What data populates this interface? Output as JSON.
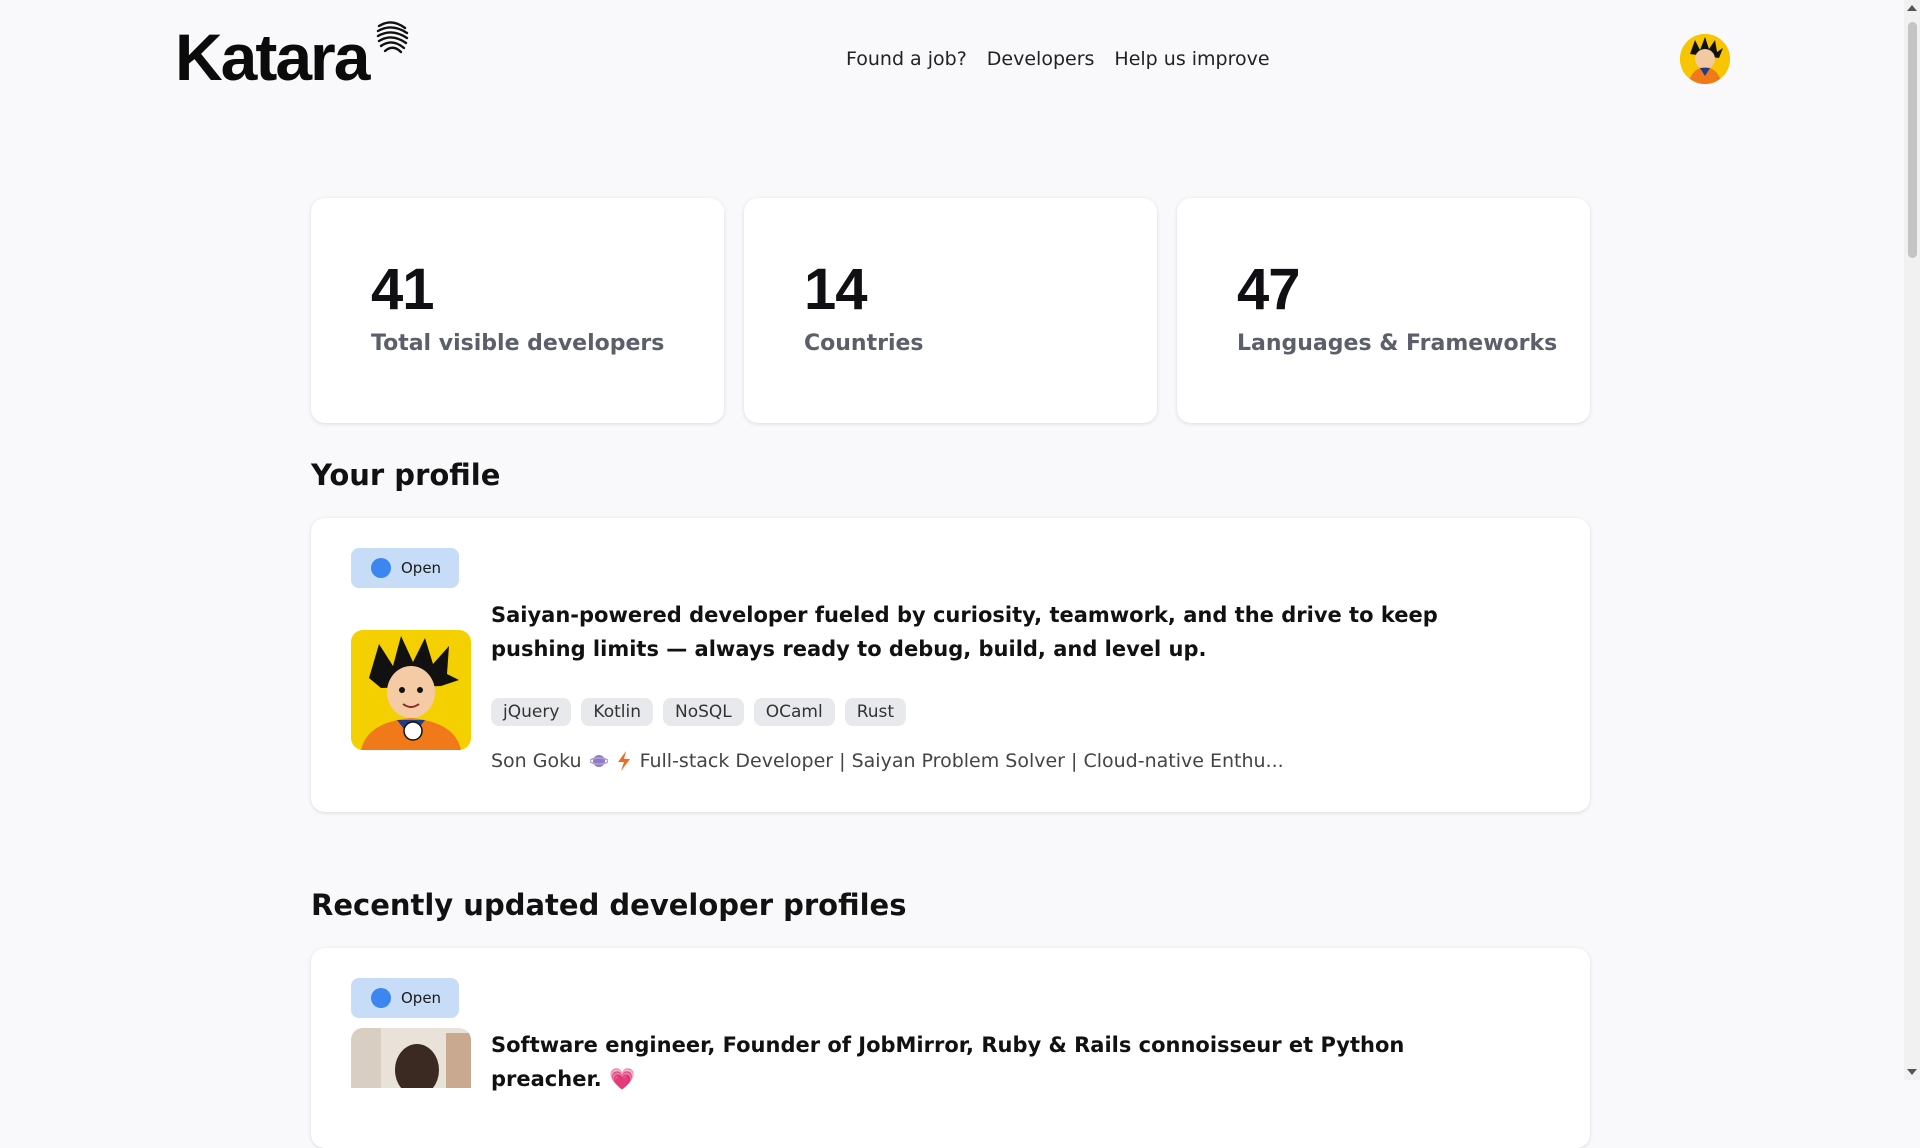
{
  "brand": {
    "name": "Katara"
  },
  "nav": {
    "items": [
      "Found a job?",
      "Developers",
      "Help us improve"
    ]
  },
  "stats": [
    {
      "value": "41",
      "label": "Total visible developers"
    },
    {
      "value": "14",
      "label": "Countries"
    },
    {
      "value": "47",
      "label": "Languages & Frameworks"
    }
  ],
  "your_profile": {
    "title": "Your profile",
    "status": "Open",
    "pitch": "Saiyan-powered developer fueled by curiosity, teamwork, and the drive to keep pushing limits — always ready to debug, build, and level up.",
    "tags": [
      "jQuery",
      "Kotlin",
      "NoSQL",
      "OCaml",
      "Rust"
    ],
    "name": "Son Goku",
    "headline": "Full-stack Developer | Saiyan Problem Solver | Cloud-native Enthu...",
    "icons": [
      "planet-emoji-icon",
      "lightning-emoji-icon"
    ]
  },
  "recent": {
    "title": "Recently updated developer profiles",
    "first": {
      "status": "Open",
      "pitch": "Software engineer, Founder of JobMirror, Ruby & Rails connoisseur et Python preacher. 💗"
    }
  },
  "colors": {
    "badge_bg": "#c7dcf7",
    "badge_dot": "#3c86f0",
    "page_bg": "#f9f9fb"
  }
}
